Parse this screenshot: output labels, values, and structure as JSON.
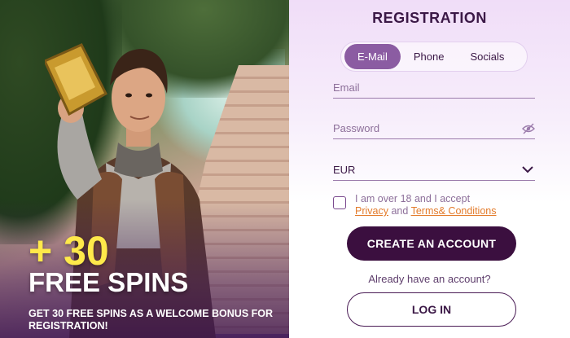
{
  "promo": {
    "headline_amount": "+ 30",
    "headline_spins": "FREE SPINS",
    "bonus_text": "GET 30 FREE SPINS AS A WELCOME BONUS FOR REGISTRATION!"
  },
  "form": {
    "title": "REGISTRATION",
    "tabs": [
      {
        "label": "E-Mail",
        "active": true
      },
      {
        "label": "Phone",
        "active": false
      },
      {
        "label": "Socials",
        "active": false
      }
    ],
    "email_label": "Email",
    "password_label": "Password",
    "currency_value": "EUR",
    "consent_text": "I am over 18 and I accept",
    "privacy_link": "Privacy",
    "and_text": "and",
    "terms_link": "Terms& Conditions",
    "create_button": "CREATE AN ACCOUNT",
    "already_text": "Already have an account?",
    "login_button": "LOG IN"
  },
  "colors": {
    "accent": "#8b5ca2",
    "primary_dark": "#3b0f3f",
    "link": "#e37b2b",
    "headline_yellow": "#ffe94a"
  },
  "icons": [
    "eye-off-icon",
    "chevron-down-icon",
    "checkbox"
  ]
}
